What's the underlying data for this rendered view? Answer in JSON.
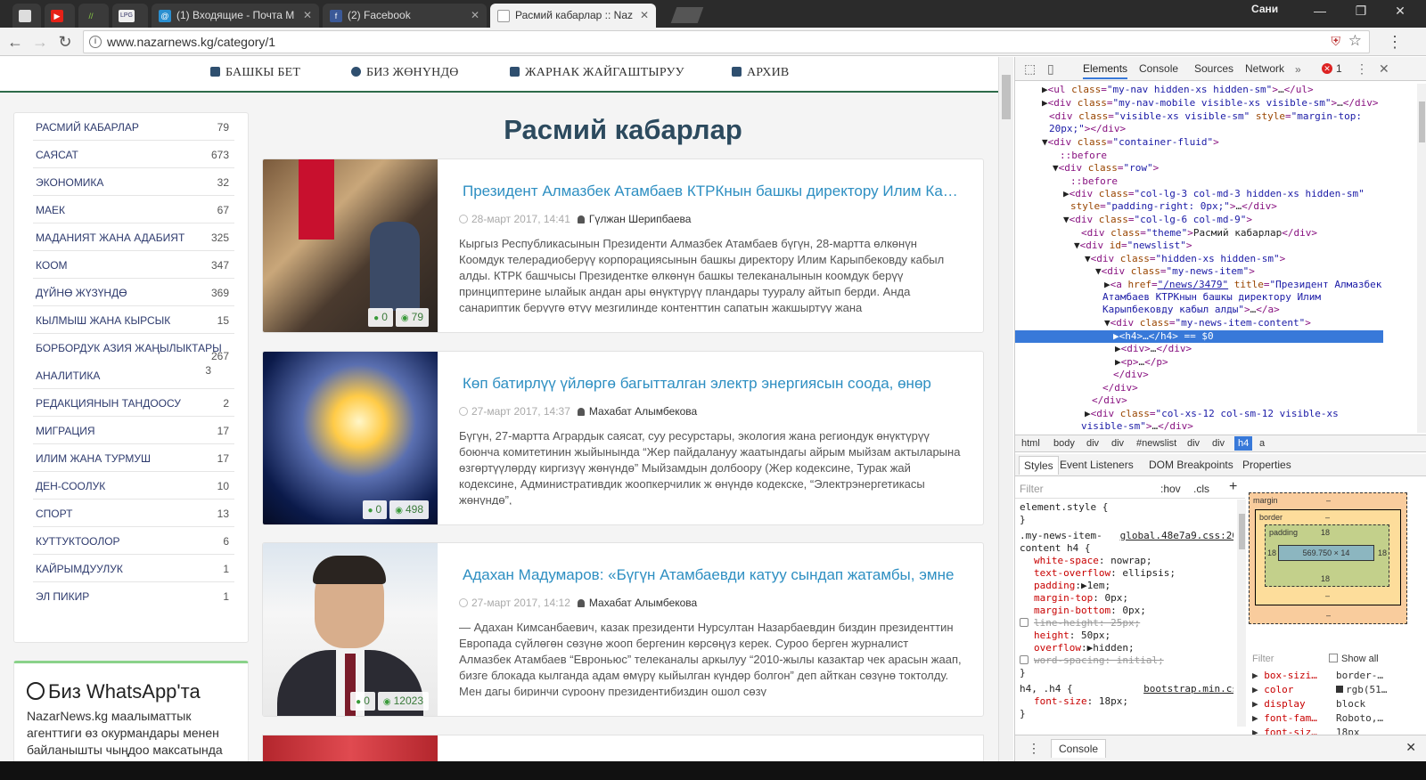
{
  "browser": {
    "tabs": [
      {
        "label": "",
        "kind": "icon",
        "icon": "page-icon"
      },
      {
        "label": "",
        "kind": "icon",
        "icon": "youtube-icon"
      },
      {
        "label": "",
        "kind": "icon",
        "icon": "site-icon"
      },
      {
        "label": "",
        "kind": "icon",
        "icon": "lpg-icon"
      },
      {
        "label": "(1) Входящие - Почта М",
        "kind": "full",
        "icon": "mail-icon"
      },
      {
        "label": "(2) Facebook",
        "kind": "full",
        "icon": "facebook-icon"
      },
      {
        "label": "Расмий кабарлар :: Naz",
        "kind": "active",
        "icon": "page-icon"
      }
    ],
    "user_name": "Сани",
    "url": "www.nazarnews.kg/category/1"
  },
  "site": {
    "nav": [
      {
        "label": "БАШКЫ БЕТ"
      },
      {
        "label": "БИЗ ЖӨНҮНДӨ"
      },
      {
        "label": "ЖАРНАК ЖАЙГАШТЫРУУ"
      },
      {
        "label": "АРХИВ"
      }
    ],
    "page_title": "Расмий кабарлар",
    "categories": [
      {
        "name": "РАСМИЙ КАБАРЛАР",
        "count": "79"
      },
      {
        "name": "САЯСАТ",
        "count": "673"
      },
      {
        "name": "ЭКОНОМИКА",
        "count": "32"
      },
      {
        "name": "МАЕК",
        "count": "67"
      },
      {
        "name": "МАДАНИЯТ ЖАНА АДАБИЯТ",
        "count": "325"
      },
      {
        "name": "КООМ",
        "count": "347"
      },
      {
        "name": "ДҮЙНӨ ЖҮЗҮНДӨ",
        "count": "369"
      },
      {
        "name": "КЫЛМЫШ ЖАНА КЫРСЫК",
        "count": "15"
      },
      {
        "name": "БОРБОРДУК АЗИЯ ЖАҢЫЛЫКТАРЫ",
        "count": "267"
      },
      {
        "name": "АНАЛИТИКА",
        "count": "3"
      },
      {
        "name": "РЕДАКЦИЯНЫН ТАНДООСУ",
        "count": "2"
      },
      {
        "name": "МИГРАЦИЯ",
        "count": "17"
      },
      {
        "name": "ИЛИМ ЖАНА ТУРМУШ",
        "count": "17"
      },
      {
        "name": "ДЕН-СООЛУК",
        "count": "10"
      },
      {
        "name": "СПОРТ",
        "count": "13"
      },
      {
        "name": "КУТТУКТООЛОР",
        "count": "6"
      },
      {
        "name": "КАЙРЫМДУУЛУК",
        "count": "1"
      },
      {
        "name": "ЭЛ ПИКИР",
        "count": "1"
      }
    ],
    "whatsapp": {
      "title": "Биз WhatsApp'та",
      "brand": "NazarNews.kg",
      "text": " маалыматтык агенттиги өз окурмандары менен байланышты чыңдоо максатында"
    },
    "articles": [
      {
        "title": "Президент Алмазбек Атамбаев КТРКнын башкы директору Илим Карыпбековду кабыл алды",
        "date": "28-март 2017, 14:41",
        "author": "Гүлжан Шерипбаева",
        "text": "Кыргыз Республикасынын Президенти Алмазбек Атамбаев бүгүн, 28-мартта өлкөнүн Коомдук телерадиоберүү корпорациясынын башкы директору Илим Карыпбековду кабыл алды. КТРК башчысы Президентке өлкөнүн башкы телеканалынын коомдук берүү принциптерине ылайык андан ары өнүктүрүү пландары тууралу айтып берди. Анда санариптик берүүгө өтүү мезгилинде контенттин сапатын жакшыртуу жана",
        "comments": "0",
        "views": "79"
      },
      {
        "title": "Көп батирлүү үйлөргө багытталган электр энергиясын соода, өнөр",
        "date": "27-март 2017, 14:37",
        "author": "Махабат Алымбекова",
        "text": "Бүгүн, 27-мартта Агрардык саясат, суу ресурстары, экология жана региондук өнүктүрүү боюнча комитетинин жыйынында “Жер пайдалануу жаатындагы айрым мыйзам актыларына өзгөртүүлөрдү киргизүү жөнүндө” Мыйзамдын долбоору (Жер кодексине, Турак жай кодексине, Административдик жоопкерчилик ж өнүндө кодекске, “Электрэнергетикасы жөнүндө”,",
        "comments": "0",
        "views": "498"
      },
      {
        "title": "Адахан Мадумаров: «Бүгүн Атамбаевди катуу сындап жатамбы, эмне",
        "date": "27-март 2017, 14:12",
        "author": "Махабат Алымбекова",
        "text": "— Адахан Кимсанбаевич, казак президенти Нурсултан Назарбаевдин биздин президенттин Европада сүйлөгөн сөзүнө жооп бергенин көрсөңүз керек. Суроо берген журналист Алмазбек Атамбаев “Евроньюс” телеканалы аркылуу “2010-жылы казактар чек арасын жаап, бизге блокада кылганда адам өмүрү кыйылган күндөр болгон” деп айткан сөзүнө токтолду. Мен дагы биринчи суроону президентибиздин ошол сөзү",
        "comments": "0",
        "views": "12023"
      }
    ]
  },
  "devtools": {
    "tabs": [
      "Elements",
      "Console",
      "Sources",
      "Network"
    ],
    "error_count": "1",
    "breadcrumb": [
      "html",
      "body",
      "div",
      "div",
      "#newslist",
      "div",
      "div",
      "h4",
      "a"
    ],
    "subtabs": [
      "Styles",
      "Event Listeners",
      "DOM Breakpoints",
      "Properties"
    ],
    "filter_placeholder": "Filter",
    "hov": ":hov",
    "cls": ".cls",
    "box_model": {
      "margin_label": "margin",
      "border_label": "border",
      "padding_label": "padding",
      "padding_value": "18",
      "content_size": "569.750 × 14",
      "dash": "–"
    },
    "computed_filter": "Filter",
    "show_all": "Show all",
    "computed": [
      {
        "prop": "box-sizi…",
        "val": "border-…"
      },
      {
        "prop": "color",
        "val": "rgb(51…"
      },
      {
        "prop": "display",
        "val": "block"
      },
      {
        "prop": "font-fam…",
        "val": "Roboto,…"
      },
      {
        "prop": "font-siz…",
        "val": "18px"
      }
    ],
    "console_label": "Console"
  }
}
